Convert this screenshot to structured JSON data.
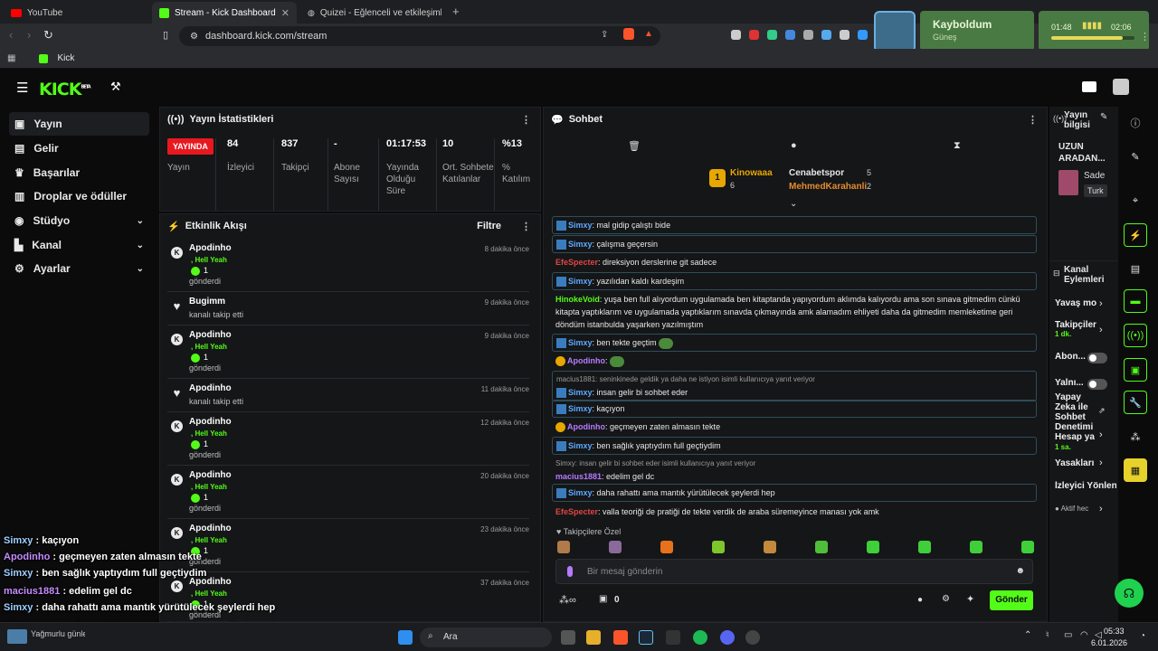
{
  "browser": {
    "tabs": [
      {
        "label": "YouTube"
      },
      {
        "label": "Stream - Kick Dashboard"
      },
      {
        "label": "Quizei - Eğlenceli ve etkileşimli quiz..."
      }
    ],
    "url": "dashboard.kick.com/stream",
    "bookmark": "Kick"
  },
  "media": {
    "title": "Kayboldum",
    "artist": "Güneş",
    "elapsed": "01:48",
    "total": "02:06",
    "progress": 0.86
  },
  "brand": {
    "logo": "KICK",
    "beta": "BETA"
  },
  "nav": [
    {
      "label": "Yayın"
    },
    {
      "label": "Gelir"
    },
    {
      "label": "Başarılar"
    },
    {
      "label": "Droplar ve ödüller"
    },
    {
      "label": "Stüdyo"
    },
    {
      "label": "Kanal"
    },
    {
      "label": "Ayarlar"
    }
  ],
  "stats": {
    "title": "Yayın İstatistikleri",
    "live_badge": "YAYINDA",
    "live_label": "Yayın",
    "items": [
      {
        "value": "84",
        "label": "İzleyici"
      },
      {
        "value": "837",
        "label": "Takipçi"
      },
      {
        "value": "-",
        "label": "Abone Sayısı"
      },
      {
        "value": "01:17:53",
        "label": "Yayında Olduğu Süre"
      },
      {
        "value": "10",
        "label": "Ort. Sohbete Katılanlar"
      },
      {
        "value": "%13",
        "label": "% Katılım"
      }
    ]
  },
  "activity": {
    "title": "Etkinlik Akışı",
    "filter": "Filtre",
    "events": [
      {
        "name": "Apodinho",
        "line2": ", Hell Yeah",
        "count": "1",
        "sub": "gönderdi",
        "time": "8 dakika önce",
        "type": "gift"
      },
      {
        "name": "Bugimm",
        "sub": "kanalı takip etti",
        "time": "9 dakika önce",
        "type": "follow"
      },
      {
        "name": "Apodinho",
        "line2": ", Hell Yeah",
        "count": "1",
        "sub": "gönderdi",
        "time": "9 dakika önce",
        "type": "gift"
      },
      {
        "name": "Apodinho",
        "sub": "kanalı takip etti",
        "time": "11 dakika önce",
        "type": "follow"
      },
      {
        "name": "Apodinho",
        "line2": ", Hell Yeah",
        "count": "1",
        "sub": "gönderdi",
        "time": "12 dakika önce",
        "type": "gift"
      },
      {
        "name": "Apodinho",
        "line2": ", Hell Yeah",
        "count": "1",
        "sub": "gönderdi",
        "time": "20 dakika önce",
        "type": "gift"
      },
      {
        "name": "Apodinho",
        "line2": ", Hell Yeah",
        "count": "1",
        "sub": "gönderdi",
        "time": "23 dakika önce",
        "type": "gift"
      },
      {
        "name": "Apodinho",
        "line2": ", Hell Yeah",
        "count": "1",
        "sub": "gönderdi",
        "time": "37 dakika önce",
        "type": "gift"
      }
    ]
  },
  "chat": {
    "title": "Sohbet",
    "leaders": {
      "first": {
        "name": "Kinowaaa",
        "count": "6"
      },
      "second": {
        "name": "Cenabetspor",
        "count": "5"
      },
      "third": {
        "name": "MehmedKarahanli",
        "count": "2"
      }
    },
    "messages": [
      {
        "user": "Simxy",
        "text": ": mal gidip çalıştı bide"
      },
      {
        "user": "Simxy",
        "text": ": çalışma geçersin"
      },
      {
        "user": "EfeSpecter",
        "text": ": direksiyon derslerine git sadece"
      },
      {
        "user": "Simxy",
        "text": ": yazılıdan kaldı kardeşim"
      },
      {
        "user": "HinokeVoid",
        "text": ": yuşa ben full alıyordum uygulamada ben kitaptanda yapıyordum aklımda kalıyordu ama son sınava gitmedim cünkü kitapta yaptıklarım ve uygulamada yaptıklarım sınavda çıkmayında amk alamadım ehliyeti daha da gitmedim memleketime geri döndüm istanbulda yaşarken yazılmıştım"
      },
      {
        "user": "Simxy",
        "text": ": ben tekte geçtim"
      },
      {
        "user": "Apodinho",
        "text": ":"
      },
      {
        "reply": "macius1881: seninkinede geldik ya daha ne istiyon isimli kullanıcıya yanıt veriyor",
        "user": "Simxy",
        "text": ": insan gelir bi sohbet eder"
      },
      {
        "user": "Simxy",
        "text": ": kaçıyon"
      },
      {
        "user": "Apodinho",
        "text": ": geçmeyen zaten almasın tekte"
      },
      {
        "user": "Simxy",
        "text": ": ben sağlık yaptıydım full geçtiydim"
      },
      {
        "reply": "Simxy: insan gelir bi sohbet eder isimli kullanıcıya yanıt veriyor",
        "user": "macius1881",
        "text": ": edelim gel dc"
      },
      {
        "user": "Simxy",
        "text": ": daha rahattı ama mantık yürütülecek şeylerdi hep"
      },
      {
        "user": "EfeSpecter",
        "text": ": valla teoriği de pratiği de tekte verdik de araba süremeyince manası yok amk"
      }
    ],
    "emote_section": "Takipçilere Özel",
    "placeholder": "Bir mesaj gönderin",
    "points": "0",
    "send": "Gönder"
  },
  "stream_info": {
    "title": "Yayın bilgisi",
    "stream_title": "UZUN ARADAN...",
    "category": "Sade",
    "tag": "Turk"
  },
  "channel_actions": {
    "title": "Kanal Eylemleri",
    "items": [
      {
        "label": "Yavaş mo"
      },
      {
        "label": "Takipçiler",
        "sub": "1 dk."
      },
      {
        "label": "Abon..."
      },
      {
        "label": "Yalnı..."
      },
      {
        "label": "Yapay Zeka ile Sohbet Denetimi Hesap ya",
        "sub": "1 sa."
      },
      {
        "label": "Yasakları"
      },
      {
        "label": "İzleyici Yönlend"
      },
      {
        "label": "Aktif hec"
      }
    ]
  },
  "overlay": [
    {
      "user": "Simxy",
      "text": " : insan gelir bi sohbet eder"
    },
    {
      "user": "Simxy",
      "text": " : kaçıyon"
    },
    {
      "user": "Apodinho",
      "text": " : geçmeyen zaten almasın tekte"
    },
    {
      "user": "Simxy",
      "text": " : ben sağlık yaptıydım full geçtiydim"
    },
    {
      "user": "macius1881",
      "text": " : edelim gel dc"
    },
    {
      "user": "Simxy",
      "text": " : daha rahattı ama mantık yürütülecek şeylerdi hep"
    },
    {
      "user": "EfeSpecter",
      "text": " : valla teoriği de pratiği de tekte verdik de araba süremeyince manası yok amk"
    }
  ],
  "taskbar": {
    "search": "Ara",
    "weather": "Yağmurlu günler...",
    "time": "05:33",
    "date": "6.01.2026"
  },
  "colors": {
    "accent": "#53fc18",
    "live": "#e7191f",
    "panel": "#151618"
  }
}
